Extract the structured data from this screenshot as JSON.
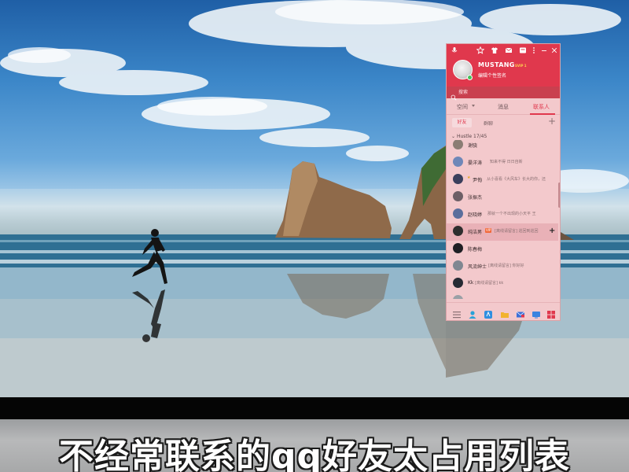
{
  "caption": "不经常联系的qq好友太占用列表",
  "qq": {
    "profile": {
      "nickname": "MUSTANG",
      "vip_tag": "SVIP 1",
      "signature": "编辑个性签名"
    },
    "search": {
      "placeholder": "搜索"
    },
    "tabs": [
      {
        "label": "空间",
        "active": false
      },
      {
        "label": "消息",
        "active": false
      },
      {
        "label": "联系人",
        "active": true
      }
    ],
    "subtabs": {
      "friends": "好友",
      "groups": "群聊"
    },
    "group": {
      "title": "Hustle 17/45"
    },
    "friends": [
      {
        "name": "谢骁",
        "signature": "",
        "vip": "",
        "avatar_color": "#8b7d74"
      },
      {
        "name": "晏洋涛",
        "signature": "知来不得 日日自新",
        "vip": "",
        "avatar_color": "#6f87b8"
      },
      {
        "name": "尹恂",
        "signature": "从小喜看《大风车》长大的你，还",
        "vip": "",
        "avatar_color": "#3b3f5c"
      },
      {
        "name": "张振杰",
        "signature": "",
        "vip": "",
        "avatar_color": "#6d5f66"
      },
      {
        "name": "赵晓婷",
        "signature": "那就一个不出现的小天平  王",
        "vip": "",
        "avatar_color": "#5a6e9c"
      },
      {
        "name": "纯洁男",
        "signature": "[离线请留言]  巡回到巡回",
        "vip": "VIP",
        "avatar_color": "#2e2e2e",
        "hover": true
      },
      {
        "name": "陈春梅",
        "signature": "",
        "vip": "",
        "avatar_color": "#1f1f24"
      },
      {
        "name": "风流绅士",
        "signature": "[离线请留言]  你好好",
        "vip": "",
        "avatar_color": "#7f8791"
      },
      {
        "name": "Kk",
        "signature": "[离线请留言]  kk",
        "vip": "",
        "avatar_color": "#262a33"
      }
    ],
    "title_bar_icons": [
      "mic-icon",
      "star-icon",
      "skin-icon",
      "mail-icon",
      "more-icon",
      "minimize-icon",
      "close-icon"
    ],
    "bottom_bar_icons": [
      "menu-icon",
      "contacts-icon",
      "app-icon",
      "folder-icon",
      "mail-icon",
      "screen-icon",
      "apps-grid-icon"
    ]
  }
}
